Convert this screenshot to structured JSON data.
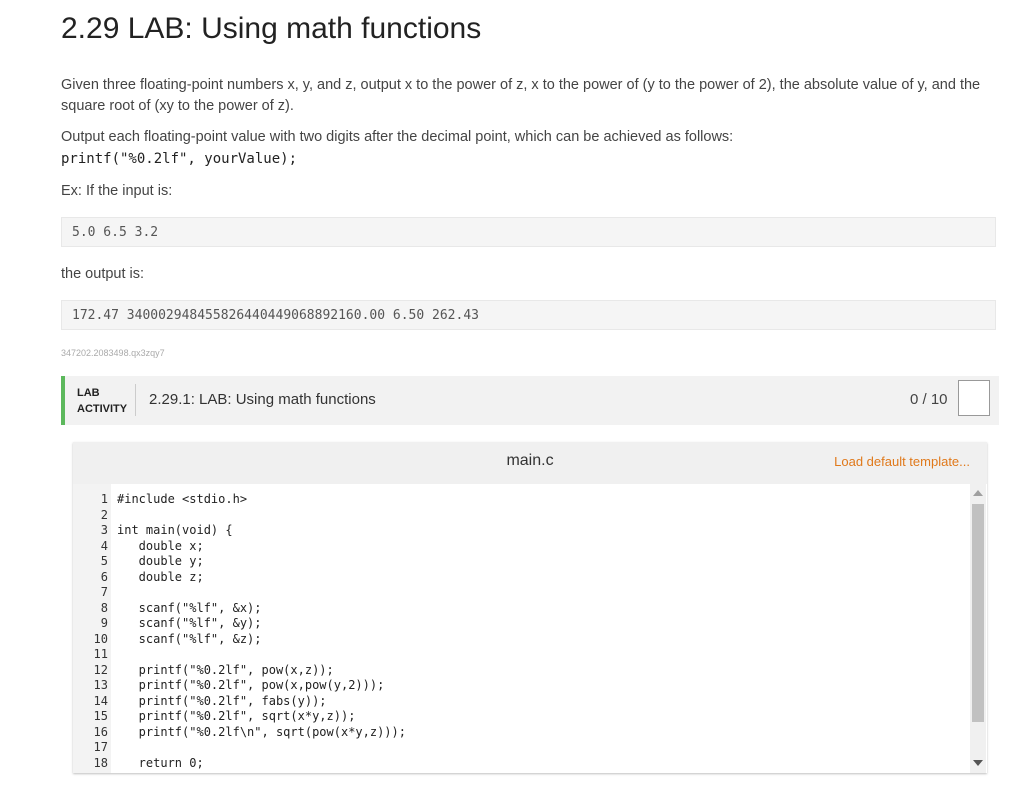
{
  "title": "2.29 LAB: Using math functions",
  "description": "Given three floating-point numbers x, y, and z, output x to the power of z, x to the power of (y to the power of 2), the absolute value of y, and the square root of (xy to the power of z).",
  "format_note": "Output each floating-point value with two digits after the decimal point, which can be achieved as follows:",
  "format_code": "printf(\"%0.2lf\", yourValue);",
  "example_intro": "Ex: If the input is:",
  "example_input": "5.0 6.5 3.2",
  "output_intro": "the output is:",
  "example_output": "172.47 340002948455826440449068892160.00 6.50 262.43",
  "ref_id": "347202.2083498.qx3zqy7",
  "lab": {
    "label_line1": "LAB",
    "label_line2": "ACTIVITY",
    "title": "2.29.1: LAB: Using math functions",
    "score": "0 / 10",
    "accent_color": "#5cb85c"
  },
  "editor": {
    "file_name": "main.c",
    "load_link": "Load default template...",
    "lines": [
      {
        "n": "1",
        "code": "#include <stdio.h>"
      },
      {
        "n": "2",
        "code": ""
      },
      {
        "n": "3",
        "code": "int main(void) {"
      },
      {
        "n": "4",
        "code": "   double x;"
      },
      {
        "n": "5",
        "code": "   double y;"
      },
      {
        "n": "6",
        "code": "   double z;"
      },
      {
        "n": "7",
        "code": ""
      },
      {
        "n": "8",
        "code": "   scanf(\"%lf\", &x);"
      },
      {
        "n": "9",
        "code": "   scanf(\"%lf\", &y);"
      },
      {
        "n": "10",
        "code": "   scanf(\"%lf\", &z);"
      },
      {
        "n": "11",
        "code": ""
      },
      {
        "n": "12",
        "code": "   printf(\"%0.2lf\", pow(x,z));"
      },
      {
        "n": "13",
        "code": "   printf(\"%0.2lf\", pow(x,pow(y,2)));"
      },
      {
        "n": "14",
        "code": "   printf(\"%0.2lf\", fabs(y));"
      },
      {
        "n": "15",
        "code": "   printf(\"%0.2lf\", sqrt(x*y,z));"
      },
      {
        "n": "16",
        "code": "   printf(\"%0.2lf\\n\", sqrt(pow(x*y,z)));"
      },
      {
        "n": "17",
        "code": ""
      },
      {
        "n": "18",
        "code": "   return 0;"
      }
    ]
  }
}
